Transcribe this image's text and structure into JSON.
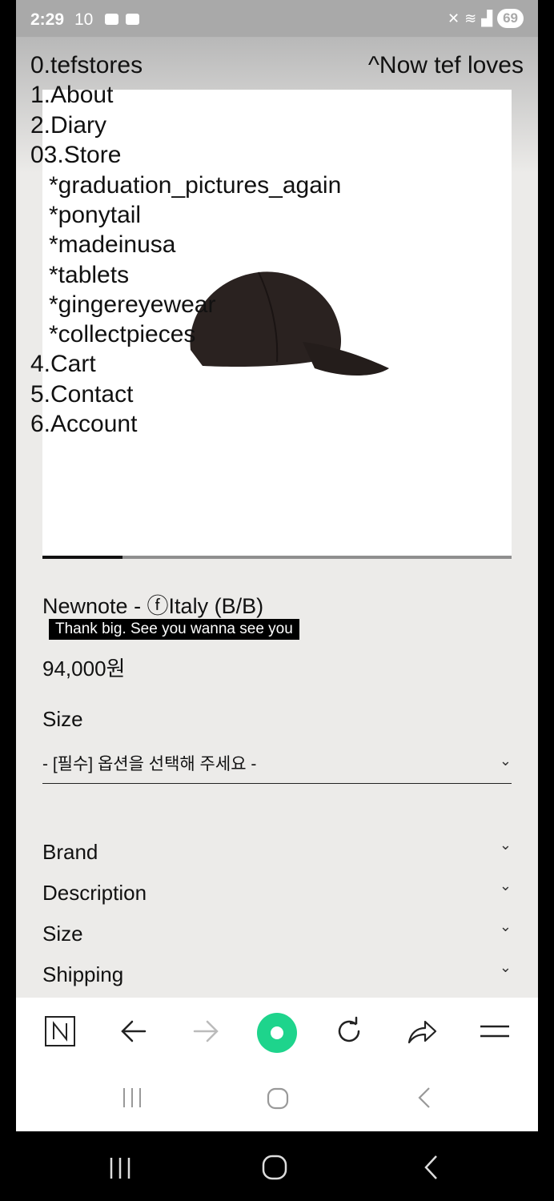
{
  "status_bar": {
    "time": "2:29",
    "extra": "10",
    "battery": "69"
  },
  "menu": {
    "brand": "0.tefstores",
    "right_link": "^Now tef loves",
    "items": [
      "1.About",
      "2.Diary",
      "03.Store"
    ],
    "store_sub": [
      "*graduation_pictures_again",
      "*ponytail",
      "*madeinusa",
      "*tablets",
      "*gingereyewear",
      "*collectpieces"
    ],
    "items_after": [
      "4.Cart",
      "5.Contact",
      "6.Account"
    ]
  },
  "product": {
    "name": "Newnote - ⓕItaly (B/B)",
    "note": "Thank big. See you wanna see you",
    "price": "94,000원",
    "image_progress": 0.17,
    "size_label": "Size",
    "size_placeholder": "- [필수] 옵션을 선택해 주세요 -"
  },
  "accordion": [
    "Brand",
    "Description",
    "Size",
    "Shipping"
  ],
  "browser": {
    "icons": [
      "naver-n-icon",
      "back-arrow-icon",
      "forward-arrow-icon",
      "green-home-icon",
      "refresh-icon",
      "share-icon",
      "menu-icon"
    ]
  },
  "colors": {
    "accent_green": "#1ed48c",
    "page_bg": "#ecebe9"
  }
}
